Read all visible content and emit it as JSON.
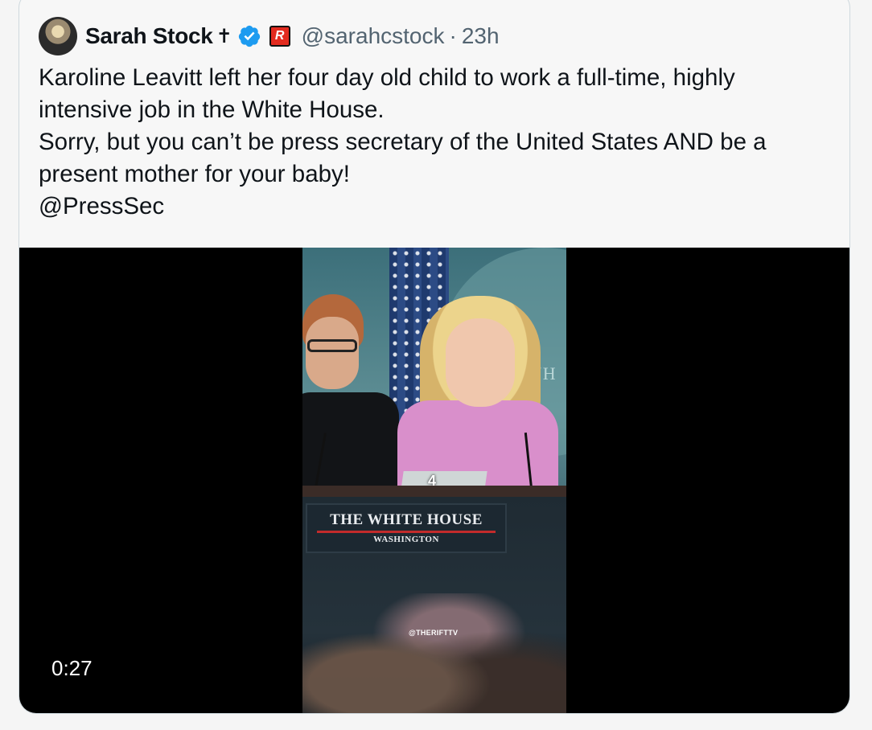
{
  "tweet": {
    "author": {
      "display_name": "Sarah Stock",
      "name_suffix_glyph": "✝",
      "handle": "@sarahcstock",
      "separator": "·",
      "timestamp": "23h",
      "verified_color": "#1d9bf0",
      "affiliate_label": "R"
    },
    "text_lines": [
      "Karoline Leavitt left her four day old child to work a full-time, highly",
      "intensive job in the White House.",
      "Sorry, but you can’t be press secretary of the United States AND be a",
      "present mother for your baby!"
    ],
    "mention": "@PressSec",
    "media": {
      "duration": "0:27",
      "caption_number": "4",
      "podium_title": "THE WHITE HOUSE",
      "podium_subtitle": "WASHINGTON",
      "watermark": "@THERIFTTV",
      "seal_text": "WH"
    }
  }
}
